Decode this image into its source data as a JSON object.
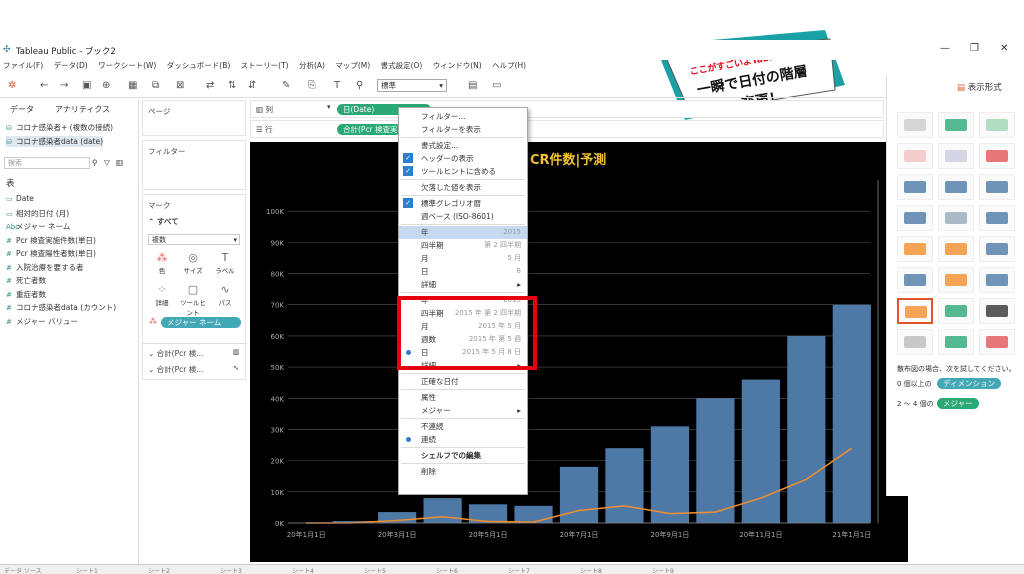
{
  "window": {
    "title": "Tableau Public - ブック2"
  },
  "menu": [
    "ファイル(F)",
    "データ(D)",
    "ワークシート(W)",
    "ダッシュボード(B)",
    "ストーリー(T)",
    "分析(A)",
    "マップ(M)",
    "書式設定(O)",
    "ウィンドウ(N)",
    "ヘルプ(H)"
  ],
  "toolbar": {
    "standard_select": "標準"
  },
  "data_pane": {
    "tab_data": "データ",
    "tab_analytics": "アナリティクス",
    "sources": [
      "コロナ感染者+ (複数の接続)",
      "コロナ感染者data (date)"
    ],
    "search_placeholder": "検索",
    "section": "表",
    "fields": [
      {
        "label": "Date",
        "icon": "▭"
      },
      {
        "label": "相対的日付 (月)",
        "icon": "▭"
      },
      {
        "label": "メジャー ネーム",
        "icon": "Abc"
      },
      {
        "label": "Pcr 検査実施件数(単日)",
        "icon": "#"
      },
      {
        "label": "Pcr 検査陽性者数(単日)",
        "icon": "#"
      },
      {
        "label": "入院治療を要する者",
        "icon": "#"
      },
      {
        "label": "死亡者数",
        "icon": "#"
      },
      {
        "label": "重症者数",
        "icon": "#"
      },
      {
        "label": "コロナ感染者data (カウント)",
        "icon": "#"
      },
      {
        "label": "メジャー バリュー",
        "icon": "#"
      }
    ]
  },
  "pages": {
    "label": "ページ"
  },
  "filters": {
    "label": "フィルター"
  },
  "marks": {
    "label": "マーク",
    "all": "すべて",
    "type": "複数",
    "buttons": [
      "色",
      "サイズ",
      "ラベル",
      "詳細",
      "ツールヒント",
      "パス"
    ],
    "pill": "メジャー ネーム",
    "sub1": "合計(Pcr 検...",
    "sub2": "合計(Pcr 検..."
  },
  "shelves": {
    "columns_label": "列",
    "rows_label": "行",
    "columns_pill": "日(Date)",
    "rows_pill": "合計(Pcr 検査実..."
  },
  "context_menu": [
    {
      "label": "フィルター...",
      "type": "item"
    },
    {
      "label": "フィルターを表示",
      "type": "item"
    },
    {
      "type": "sep"
    },
    {
      "label": "書式設定...",
      "type": "item"
    },
    {
      "label": "ヘッダーの表示",
      "type": "check"
    },
    {
      "label": "ツールヒントに含める",
      "type": "check"
    },
    {
      "type": "sep"
    },
    {
      "label": "欠落した値を表示",
      "type": "item"
    },
    {
      "type": "sep"
    },
    {
      "label": "標準グレゴリオ暦",
      "type": "check"
    },
    {
      "label": "週ベース (ISO-8601)",
      "type": "item"
    },
    {
      "type": "sep"
    },
    {
      "label": "年",
      "right": "2015",
      "type": "hl"
    },
    {
      "label": "四半期",
      "right": "第 2 四半期",
      "type": "item"
    },
    {
      "label": "月",
      "right": "5 月",
      "type": "item"
    },
    {
      "label": "日",
      "right": "8",
      "type": "item"
    },
    {
      "label": "詳細",
      "type": "sub"
    },
    {
      "type": "sep"
    },
    {
      "label": "年",
      "right": "2015",
      "type": "item"
    },
    {
      "label": "四半期",
      "right": "2015 年 第 2 四半期",
      "type": "item"
    },
    {
      "label": "月",
      "right": "2015 年 5 月",
      "type": "item"
    },
    {
      "label": "週数",
      "right": "2015 年 第 5 週",
      "type": "item"
    },
    {
      "label": "日",
      "right": "2015 年 5 月 8 日",
      "type": "dot"
    },
    {
      "label": "詳細",
      "type": "sub"
    },
    {
      "type": "sep"
    },
    {
      "label": "正確な日付",
      "type": "item"
    },
    {
      "type": "sep"
    },
    {
      "label": "属性",
      "type": "item"
    },
    {
      "label": "メジャー",
      "type": "sub"
    },
    {
      "type": "sep"
    },
    {
      "label": "不連続",
      "type": "item"
    },
    {
      "label": "連続",
      "type": "dot"
    },
    {
      "type": "sep"
    },
    {
      "label": "シェルフでの編集",
      "type": "bold"
    },
    {
      "type": "sep"
    },
    {
      "label": "削除",
      "type": "item"
    }
  ],
  "show_me": {
    "title": "表示形式",
    "hint": "散布図の場合、次を試してください。",
    "line1_pre": "0 個以上の",
    "line1_pill": "ディメンション",
    "line2_pre": "2 ～ 4 個の",
    "line2_pill": "メジャー"
  },
  "banner": {
    "line1": "ここがすごいよTableau！",
    "line2": "一瞬で日付の階層",
    "line3": "変更！"
  },
  "chart_data": {
    "type": "bar",
    "title": "CR件数|予測",
    "y_ticks": [
      "0K",
      "10K",
      "20K",
      "30K",
      "40K",
      "50K",
      "60K",
      "70K",
      "80K",
      "90K",
      "100K"
    ],
    "x_ticks": [
      "20年1月1日",
      "20年3月1日",
      "20年5月1日",
      "20年7月1日",
      "20年9月1日",
      "20年11月1日",
      "21年1月1日"
    ],
    "ylim": [
      0,
      110000
    ],
    "x": [
      "2020-01",
      "2020-02",
      "2020-03",
      "2020-04",
      "2020-05",
      "2020-06",
      "2020-07",
      "2020-08",
      "2020-09",
      "2020-10",
      "2020-11",
      "2020-12",
      "2021-01"
    ],
    "series": [
      {
        "name": "Pcr 検査実施件数(単日)",
        "values": [
          0,
          600,
          3500,
          8000,
          6000,
          5500,
          18000,
          24000,
          31000,
          40000,
          46000,
          60000,
          70000
        ]
      },
      {
        "name": "Pcr 検査陽性者数(単日)",
        "values": [
          0,
          50,
          800,
          2000,
          500,
          300,
          4000,
          5500,
          3000,
          3500,
          8000,
          14000,
          24000
        ]
      }
    ],
    "colors": {
      "bar": "#4e79a7",
      "line": "#f28e2b",
      "bg": "#000000",
      "grid": "#555555",
      "title": "#f2c230"
    }
  },
  "status_tabs": [
    "データ ソース",
    "シート1",
    "シート2",
    "シート3",
    "シート4",
    "シート5",
    "シート6",
    "シート7",
    "シート8",
    "シート9"
  ]
}
